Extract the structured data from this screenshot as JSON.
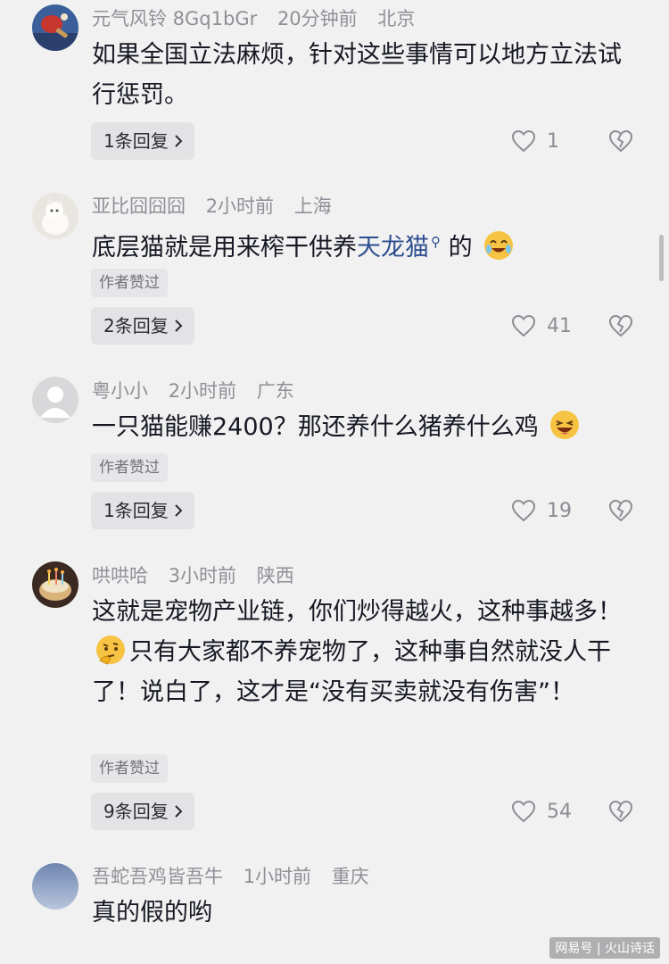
{
  "comments": [
    {
      "user": "元气风铃 8Gq1bGr",
      "time": "20分钟前",
      "location": "北京",
      "text_parts": [
        "如果全国立法麻烦，针对这些事情可以地方立法试行惩罚。"
      ],
      "replies_label": "1条回复",
      "likes": "1"
    },
    {
      "user": "亚比囧囧囧",
      "time": "2小时前",
      "location": "上海",
      "text_parts": [
        "底层猫就是用来榨干供养",
        "天龙猫",
        "的"
      ],
      "author_tag": "作者赞过",
      "replies_label": "2条回复",
      "likes": "41"
    },
    {
      "user": "粤小小",
      "time": "2小时前",
      "location": "广东",
      "text_parts": [
        "一只猫能赚2400？那还养什么猪养什么鸡"
      ],
      "author_tag": "作者赞过",
      "replies_label": "1条回复",
      "likes": "19"
    },
    {
      "user": "哄哄哈",
      "time": "3小时前",
      "location": "陕西",
      "text_parts": [
        "这就是宠物产业链，你们炒得越火，这种事越多！",
        "只有大家都不养宠物了，这种事自然就没人干了！说白了，这才是“没有买卖就没有伤害”！"
      ],
      "author_tag": "作者赞过",
      "replies_label": "9条回复",
      "likes": "54"
    },
    {
      "user": "吾蛇吾鸡皆吾牛",
      "time": "1小时前",
      "location": "重庆",
      "text_parts": [
        "真的假的哟"
      ]
    }
  ],
  "watermark": "网易号 | 火山诗话",
  "icons": {
    "like": "heart-outline-icon",
    "dislike": "broken-heart-icon",
    "reply_chevron": "chevron-right-icon",
    "search_hint": "search-icon"
  },
  "colors": {
    "background": "#f1f1f1",
    "username": "#8f9097",
    "text": "#161823",
    "link": "#2d4e8f"
  }
}
